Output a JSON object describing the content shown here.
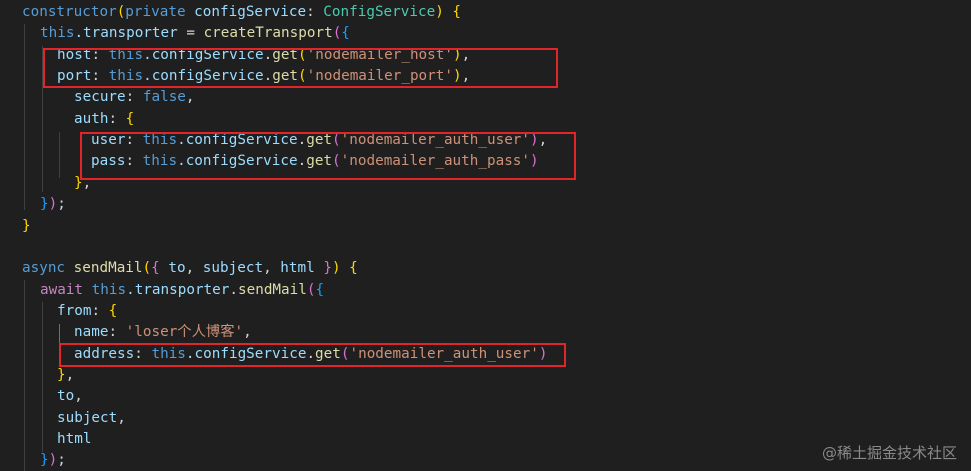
{
  "code": {
    "l1": {
      "a": "constructor",
      "b": "(",
      "c": "private",
      "d": " configService",
      "e": ": ",
      "f": "ConfigService",
      "g": ")",
      "h": " {"
    },
    "l2": {
      "a": "this",
      "b": ".transporter",
      "c": " = ",
      "d": "createTransport",
      "e": "(",
      "f": "{"
    },
    "l3": {
      "a": "host",
      "b": ": ",
      "c": "this",
      "d": ".configService",
      "e": ".",
      "f": "get",
      "g": "(",
      "h": "'nodemailer_host'",
      "i": ")",
      "j": ","
    },
    "l4": {
      "a": "port",
      "b": ": ",
      "c": "this",
      "d": ".configService",
      "e": ".",
      "f": "get",
      "g": "(",
      "h": "'nodemailer_port'",
      "i": ")",
      "j": ","
    },
    "l5": {
      "a": "secure",
      "b": ": ",
      "c": "false",
      "d": ","
    },
    "l6": {
      "a": "auth",
      "b": ": ",
      "c": "{"
    },
    "l7": {
      "a": "user",
      "b": ": ",
      "c": "this",
      "d": ".configService",
      "e": ".",
      "f": "get",
      "g": "(",
      "h": "'nodemailer_auth_user'",
      "i": ")",
      "j": ","
    },
    "l8": {
      "a": "pass",
      "b": ": ",
      "c": "this",
      "d": ".configService",
      "e": ".",
      "f": "get",
      "g": "(",
      "h": "'nodemailer_auth_pass'",
      "i": ")"
    },
    "l9": {
      "a": "}",
      "b": ","
    },
    "l10": {
      "a": "}",
      "b": ")",
      "c": ";"
    },
    "l11": {
      "a": "}"
    },
    "l13": {
      "a": "async",
      "b": " ",
      "c": "sendMail",
      "d": "(",
      "e": "{",
      "f": " to",
      "g": ", ",
      "h": "subject",
      "i": ", ",
      "j": "html",
      "k": " ",
      "l": "}",
      "m": ")",
      "n": " {"
    },
    "l14": {
      "a": "await",
      "b": " ",
      "c": "this",
      "d": ".transporter",
      "e": ".",
      "f": "sendMail",
      "g": "(",
      "h": "{"
    },
    "l15": {
      "a": "from",
      "b": ": ",
      "c": "{"
    },
    "l16": {
      "a": "name",
      "b": ": ",
      "c": "'loser个人博客'",
      "d": ","
    },
    "l17": {
      "a": "address",
      "b": ": ",
      "c": "this",
      "d": ".configService",
      "e": ".",
      "f": "get",
      "g": "(",
      "h": "'nodemailer_auth_user'",
      "i": ")"
    },
    "l18": {
      "a": "}",
      "b": ","
    },
    "l19": {
      "a": "to",
      "b": ","
    },
    "l20": {
      "a": "subject",
      "b": ","
    },
    "l21": {
      "a": "html"
    },
    "l22": {
      "a": "}",
      "b": ")",
      "c": ";"
    }
  },
  "watermark": "@稀土掘金技术社区",
  "colors": {
    "background": "#1f1f1f",
    "keyword": "#569cd6",
    "control": "#c586c0",
    "function": "#dcdcaa",
    "variable": "#9cdcfe",
    "type": "#4ec9b0",
    "string": "#ce9178",
    "highlight_box": "#e0252b"
  }
}
